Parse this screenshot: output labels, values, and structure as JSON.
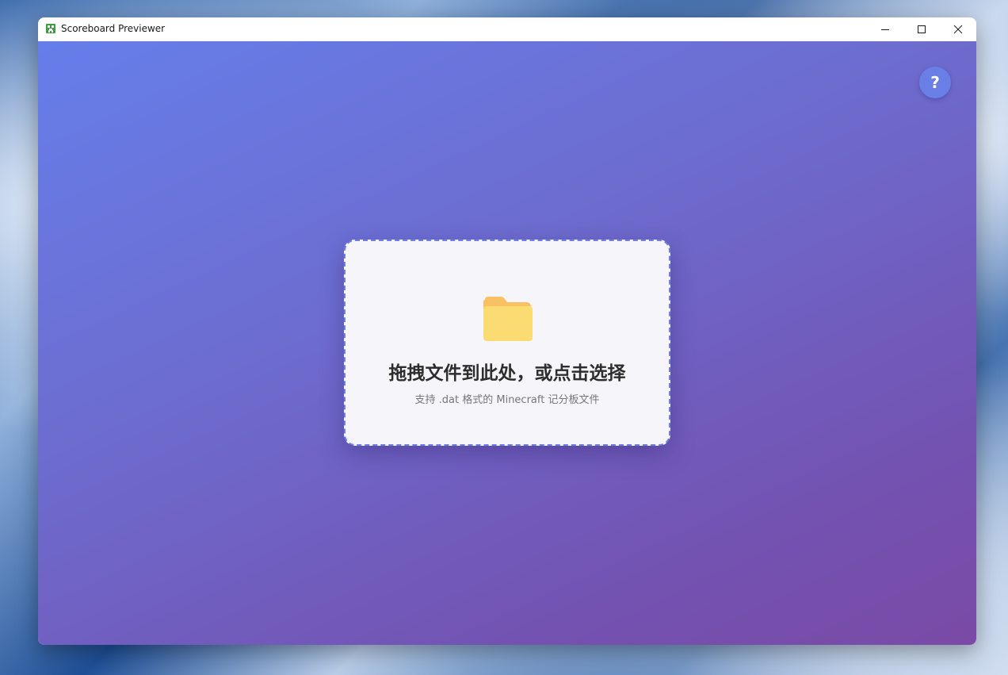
{
  "window": {
    "title": "Scoreboard Previewer",
    "icon": "minecraft-creeper-icon",
    "controls": {
      "minimize": "minimize-icon",
      "maximize": "maximize-icon",
      "close": "close-icon"
    }
  },
  "help": {
    "label": "?"
  },
  "dropzone": {
    "icon": "folder-icon",
    "title": "拖拽文件到此处，或点击选择",
    "subtitle": "支持 .dat 格式的 Minecraft 记分板文件"
  },
  "colors": {
    "gradient_start": "#667eea",
    "gradient_end": "#7a4aa6",
    "dropzone_bg": "#f6f6fa",
    "dropzone_border": "#6f7fe0",
    "folder": "#fbdc73",
    "folder_tab": "#f9c064",
    "help_button": "#6a7fe6"
  }
}
